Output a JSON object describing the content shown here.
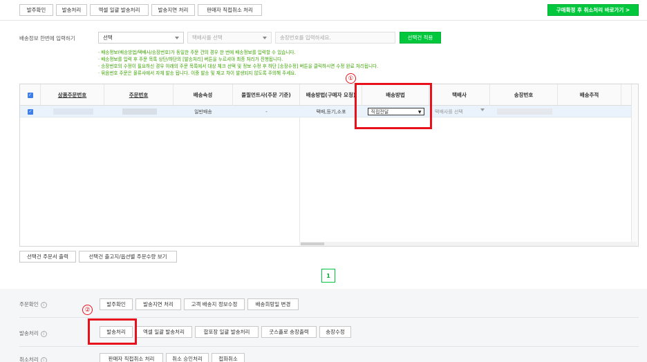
{
  "top_toolbar": {
    "buttons": [
      "발주확인",
      "발송처리",
      "엑셀 일괄 발송처리",
      "발송지연 처리",
      "판매자 직접취소 처리"
    ],
    "right_button": "구매확정 후 취소처리 바로가기 >"
  },
  "bulk_input": {
    "label": "배송정보 한번에 입력하기",
    "method_select": "선택",
    "courier_select": "택배사를 선택",
    "tracking_placeholder": "송장번호를 입력하세요.",
    "apply_button": "선택건 적용"
  },
  "notes": [
    "· 배송정보(배송방법/택배사/송장번호)가 동일한 주문 건의 경우 한 번에 배송정보를 입력할 수 있습니다.",
    "· 배송정보를 입력 후 주문 목록 상단/하단의 [발송처리] 버튼을 누르셔야 최종 처리가 진행됩니다.",
    "· 송장번호의 수정이 필요하신 경우 아래의 주문 목록에서 대상 체크 선택 및 정보 수정 후 하단 [송장수정] 버튼을 클릭하시면 수정 완료 처리됩니다.",
    "· 묶음번호 주문은 물류사에서 자체 발송 됩니다. 이중 발송 및 재고 차이 발생되지 않도록 주의해 주세요."
  ],
  "grid": {
    "headers": [
      "상품주문번호",
      "주문번호",
      "배송속성",
      "풀필먼트사(주문 기준)",
      "배송방법(구매자 요청)",
      "배송방법",
      "택배사",
      "송장번호",
      "배송추적"
    ],
    "row": {
      "delivery_attr": "일반배송",
      "fulfillment": "-",
      "requested_method": "택배,등기,소포",
      "method_value": "직접전달",
      "courier_value": "택배사를 선택"
    }
  },
  "grid_actions": [
    "선택건 주문서 출력",
    "선택건 출고지/옵션별 주문수량 보기"
  ],
  "pagination": {
    "current": "1"
  },
  "annotations": {
    "marker1": "①",
    "marker2": "②"
  },
  "sections": [
    {
      "title": "주문확인",
      "buttons": [
        "발주확인",
        "발송지연 처리",
        "고객 배송지 정보수정",
        "배송희망일 변경"
      ]
    },
    {
      "title": "발송처리",
      "buttons": [
        "발송처리",
        "엑셀 일괄 발송처리",
        "합포장 일괄 발송처리",
        "굿스플로 송장출력",
        "송장수정"
      ]
    },
    {
      "title": "취소처리",
      "buttons": [
        "판매자 직접취소 처리",
        "취소 승인처리",
        "접화취소"
      ]
    }
  ],
  "colors": {
    "accent": "#00c73c",
    "annotation": "#e8101a",
    "note_text": "#3aa400"
  }
}
